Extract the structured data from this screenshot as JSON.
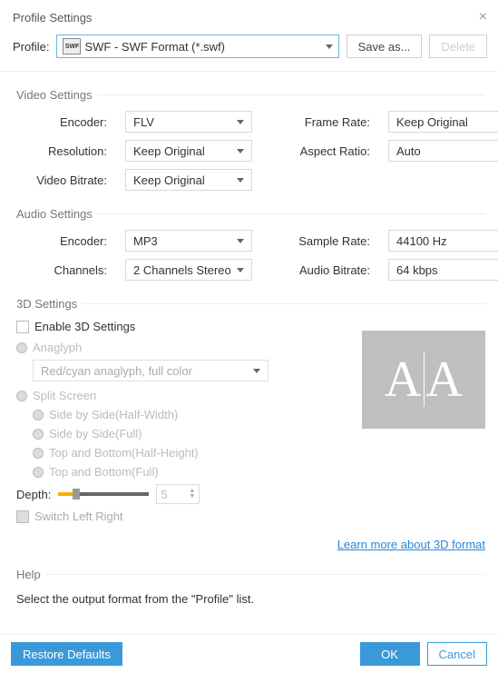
{
  "title": "Profile Settings",
  "profile": {
    "label": "Profile:",
    "value": "SWF - SWF Format (*.swf)",
    "save_as": "Save as...",
    "delete": "Delete"
  },
  "video": {
    "header": "Video Settings",
    "encoder_label": "Encoder:",
    "encoder": "FLV",
    "frame_rate_label": "Frame Rate:",
    "frame_rate": "Keep Original",
    "resolution_label": "Resolution:",
    "resolution": "Keep Original",
    "aspect_ratio_label": "Aspect Ratio:",
    "aspect_ratio": "Auto",
    "bitrate_label": "Video Bitrate:",
    "bitrate": "Keep Original"
  },
  "audio": {
    "header": "Audio Settings",
    "encoder_label": "Encoder:",
    "encoder": "MP3",
    "sample_rate_label": "Sample Rate:",
    "sample_rate": "44100 Hz",
    "channels_label": "Channels:",
    "channels": "2 Channels Stereo",
    "bitrate_label": "Audio Bitrate:",
    "bitrate": "64 kbps"
  },
  "threeD": {
    "header": "3D Settings",
    "enable_label": "Enable 3D Settings",
    "anaglyph_label": "Anaglyph",
    "anaglyph_value": "Red/cyan anaglyph, full color",
    "split_label": "Split Screen",
    "options": [
      "Side by Side(Half-Width)",
      "Side by Side(Full)",
      "Top and Bottom(Half-Height)",
      "Top and Bottom(Full)"
    ],
    "depth_label": "Depth:",
    "depth_value": "5",
    "switch_label": "Switch Left Right",
    "learn_more": "Learn more about 3D format"
  },
  "help": {
    "header": "Help",
    "text": "Select the output format from the \"Profile\" list."
  },
  "footer": {
    "restore": "Restore Defaults",
    "ok": "OK",
    "cancel": "Cancel"
  }
}
